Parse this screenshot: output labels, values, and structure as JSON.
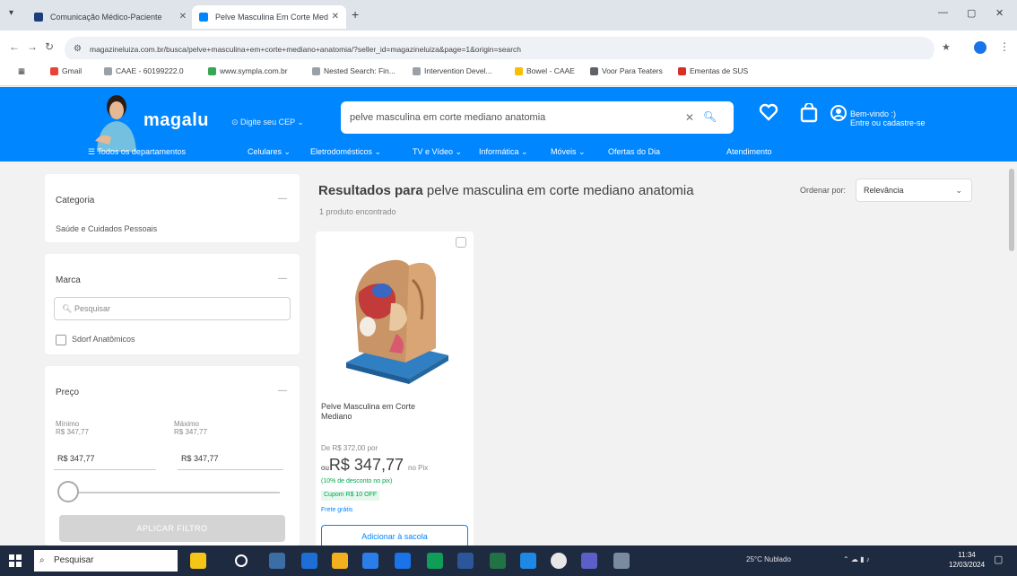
{
  "browser": {
    "tabs": [
      {
        "title": "Comunicação Médico-Paciente",
        "active": false
      },
      {
        "title": "Pelve Masculina Em Corte Med",
        "active": true
      }
    ],
    "url": "magazineluiza.com.br/busca/pelve+masculina+em+corte+mediano+anatomia/?seller_id=magazineluiza&page=1&origin=search",
    "bookmarks": [
      "Gmail",
      "CAAE - 60199222.0",
      "www.sympla.com.br",
      "Nested Search: Fin...",
      "Intervention Devel...",
      "Bowel - CAAE",
      "Voor Para Teaters",
      "Ementas de SUS"
    ]
  },
  "header": {
    "logo": "magalu",
    "cep": "Digite seu CEP",
    "search_value": "pelve masculina em corte mediano anatomia",
    "login_line1": "Bem-vindo :)",
    "login_line2": "Entre ou cadastre-se",
    "menu_label": "Todos os departamentos",
    "categories": [
      "Celulares",
      "Eletrodomésticos",
      "TV e Vídeo",
      "Informática",
      "Móveis",
      "Ofertas do Dia",
      "Atendimento"
    ]
  },
  "filters": {
    "category": {
      "title": "Categoria",
      "item": "Saúde e Cuidados Pessoais"
    },
    "brand": {
      "title": "Marca",
      "placeholder": "Pesquisar",
      "item": "Sdorf Anatômicos"
    },
    "price": {
      "title": "Preço",
      "min_label": "Mínimo",
      "min_sub": "R$ 347,77",
      "max_label": "Máximo",
      "max_sub": "R$ 347,77",
      "min_value": "R$ 347,77",
      "max_value": "R$ 347,77",
      "apply": "APLICAR FILTRO"
    }
  },
  "results": {
    "title_bold": "Resultados para",
    "query": "pelve masculina em corte mediano anatomia",
    "count": "1 produto encontrado",
    "sort_label": "Ordenar por:",
    "sort_value": "Relevância"
  },
  "product": {
    "title": "Pelve Masculina em Corte Mediano",
    "old_price": "De R$ 372,00 por",
    "price_prefix": "ou",
    "price": "R$ 347,77",
    "pix": "no Pix",
    "promo": "(10% de desconto no pix)",
    "coupon": "Cupom R$ 10 OFF",
    "shipping": "Frete grátis",
    "add_button": "Adicionar à sacola"
  },
  "taskbar": {
    "search_placeholder": "Pesquisar",
    "weather": "25°C Nublado",
    "time": "11:34",
    "date": "12/03/2024"
  },
  "colors": {
    "brand": "#0086ff",
    "price_green": "#00a650"
  }
}
